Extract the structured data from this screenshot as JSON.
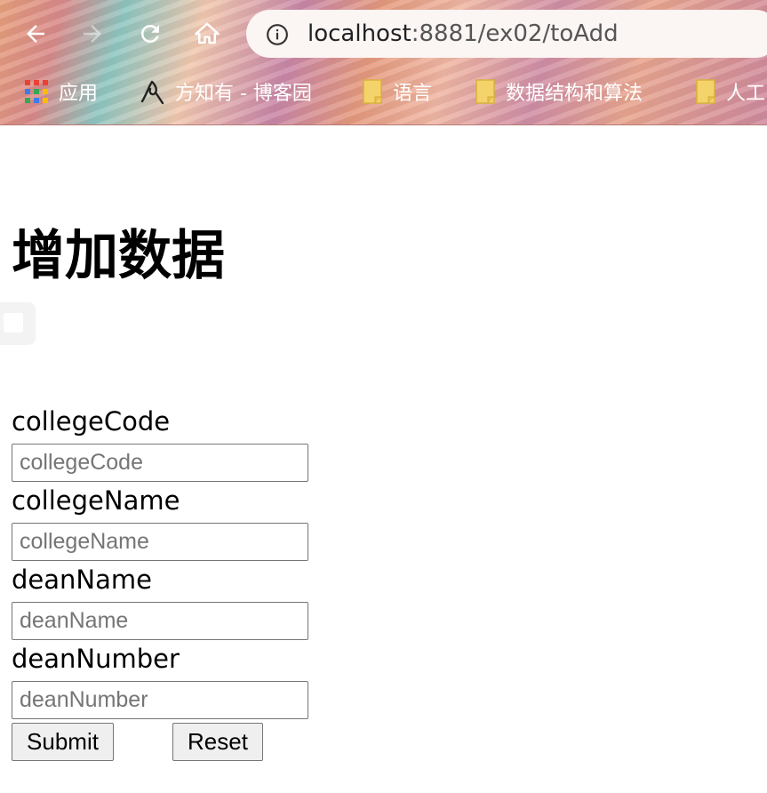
{
  "browser": {
    "url_host": "localhost",
    "url_path": ":8881/ex02/toAdd",
    "bookmarks": [
      {
        "label": "应用",
        "icon": "apps-grid-icon"
      },
      {
        "label": "方知有 - 博客园",
        "icon": "blog-favicon-icon"
      },
      {
        "label": "语言",
        "icon": "folder-icon"
      },
      {
        "label": "数据结构和算法",
        "icon": "folder-icon"
      },
      {
        "label": "人工",
        "icon": "folder-icon"
      }
    ]
  },
  "page": {
    "title": "增加数据",
    "fields": [
      {
        "label": "collegeCode",
        "placeholder": "collegeCode"
      },
      {
        "label": "collegeName",
        "placeholder": "collegeName"
      },
      {
        "label": "deanName",
        "placeholder": "deanName"
      },
      {
        "label": "deanNumber",
        "placeholder": "deanNumber"
      }
    ],
    "submit_label": "Submit",
    "reset_label": "Reset"
  },
  "colors": {
    "folder": "#f5d36b",
    "bookmark_text": "#ffffff"
  }
}
